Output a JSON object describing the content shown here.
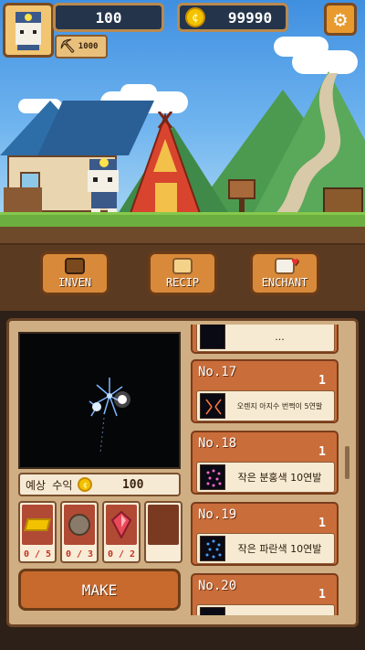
{
  "hud": {
    "level": "100",
    "pickaxe_count": "1000",
    "gold": "99990",
    "avatar_icon": "cat-miner-icon",
    "settings_icon": "gear-icon"
  },
  "menu": [
    {
      "label": "INVEN",
      "icon": "chest-icon",
      "color": "#7a4a1e"
    },
    {
      "label": "RECIP",
      "icon": "book-icon",
      "color": "#f3d38a"
    },
    {
      "label": "ENCHANT",
      "icon": "cat-face-icon",
      "color": "#f4f0e6"
    }
  ],
  "craft": {
    "income_label": "예상 수익",
    "income_value": "100",
    "ingredients": [
      {
        "icon": "gold-bar-icon",
        "count": "0 / 5",
        "color": "#f2c200"
      },
      {
        "icon": "ore-icon",
        "count": "0 / 3",
        "color": "#8a7a6a"
      },
      {
        "icon": "red-gem-icon",
        "count": "0 / 2",
        "color": "#e84a5a"
      },
      {
        "icon": "empty-slot",
        "count": "",
        "color": ""
      }
    ],
    "make_label": "MAKE"
  },
  "recipes": [
    {
      "no": "",
      "qty": "",
      "name": "..."
    },
    {
      "no": "No.17",
      "qty": "1",
      "name": "오렌지 아지수 번쩍이 5연발",
      "color": "#ff7a3a"
    },
    {
      "no": "No.18",
      "qty": "1",
      "name": "작은 분홍색 10연발",
      "color": "#ff66cc"
    },
    {
      "no": "No.19",
      "qty": "1",
      "name": "작은 파란색 10연발",
      "color": "#4aa0ff"
    },
    {
      "no": "No.20",
      "qty": "1",
      "name": "...",
      "color": "#4aa0ff"
    }
  ]
}
